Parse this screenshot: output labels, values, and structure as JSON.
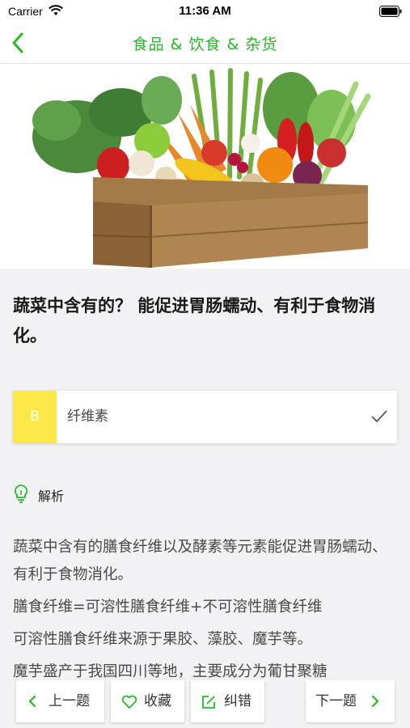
{
  "status_bar": {
    "carrier": "Carrier",
    "time": "11:36 AM"
  },
  "nav": {
    "title": "食品 & 饮食 & 杂货"
  },
  "question": {
    "text": "蔬菜中含有的？ 能促进胃肠蠕动、有利于食物消化。"
  },
  "answer": {
    "letter": "B",
    "text": "纤维素"
  },
  "analysis": {
    "label": "解析",
    "paragraphs": [
      "蔬菜中含有的膳食纤维以及酵素等元素能促进胃肠蠕动、有利于食物消化。",
      "膳食纤维=可溶性膳食纤维+不可溶性膳食纤维",
      "可溶性膳食纤维来源于果胶、藻胶、魔芋等。",
      "魔芋盛产于我国四川等地，主要成分为葡甘聚糖"
    ]
  },
  "bottom_bar": {
    "prev_label": "上一题",
    "favorite_label": "收藏",
    "correct_label": "纠错",
    "next_label": "下一题"
  },
  "colors": {
    "accent": "#22bb22",
    "answer_letter_bg": "#fce849"
  }
}
